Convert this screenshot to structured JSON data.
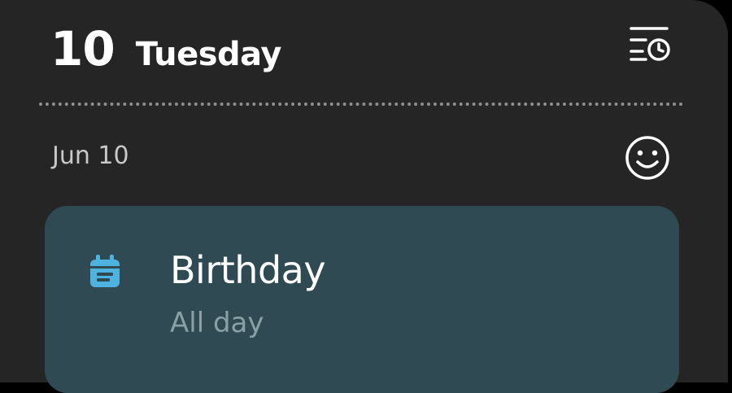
{
  "header": {
    "day_number": "10",
    "weekday": "Tuesday",
    "schedule_icon": "list-clock-icon"
  },
  "section": {
    "date_label": "Jun 10",
    "mood_icon": "smiley-icon"
  },
  "events": [
    {
      "title": "Birthday",
      "time": "All day",
      "icon": "calendar-icon",
      "color": "#2f4a52",
      "icon_color": "#4fb3e0"
    }
  ],
  "colors": {
    "background": "#252525",
    "divider": "#8f8f8f"
  }
}
